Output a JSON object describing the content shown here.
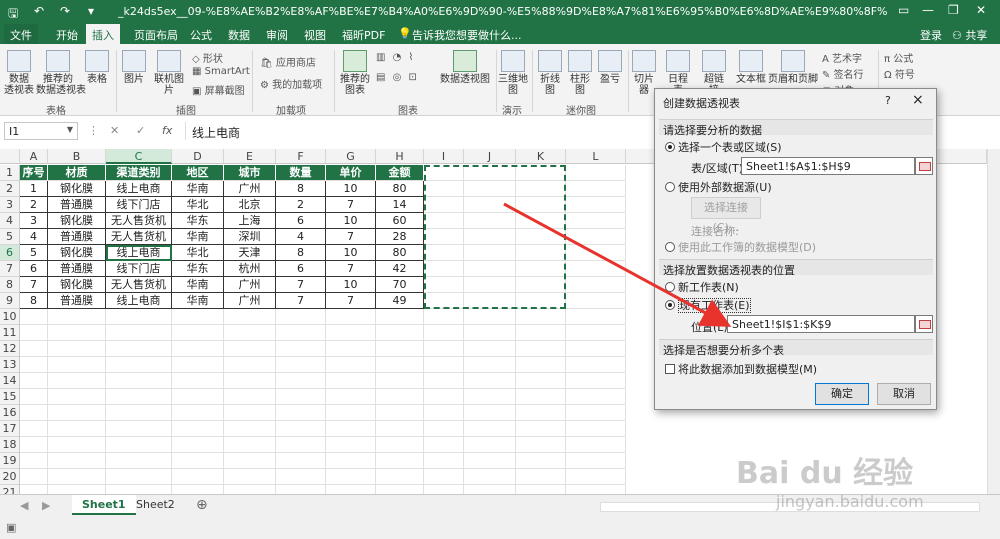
{
  "titlebar": {
    "title": "_k24ds5ex__09-%E8%AE%B2%E8%AF%BE%E7%B4%A0%E6%9D%90-%E5%88%9D%E8%A7%81%E6%95%B0%E6%8D%AE%E9%80%8F%E8%A7%86%E8%A1%A8-%E7%A9%..."
  },
  "tabs": [
    "文件",
    "开始",
    "插入",
    "页面布局",
    "公式",
    "数据",
    "审阅",
    "视图",
    "福昕PDF"
  ],
  "tell_me": "告诉我您想要做什么...",
  "user": {
    "login": "登录",
    "share": "共享"
  },
  "ribbon": {
    "tables": {
      "pivot": "数据\n透视表",
      "recommended": "推荐的\n数据透视表",
      "table": "表格",
      "group": "表格"
    },
    "illustrations": {
      "picture": "图片",
      "online_picture": "联机图片",
      "shapes": "形状",
      "smartart": "SmartArt",
      "screenshot": "屏幕截图",
      "group": "插图"
    },
    "addins": {
      "store": "应用商店",
      "my_addins": "我的加载项",
      "group": "加载项"
    },
    "charts": {
      "recommended": "推荐的\n图表",
      "pivot_chart": "数据透视图",
      "group": "图表"
    },
    "tours": {
      "map3d": "三维地\n图",
      "group": "演示"
    },
    "sparklines": {
      "line": "折线图",
      "column": "柱形图",
      "winloss": "盈亏",
      "group": "迷你图"
    },
    "filters": {
      "slicer": "切片器",
      "timeline": "日程表"
    },
    "links": {
      "hyperlink": "超链接"
    },
    "text": {
      "textbox": "文本框",
      "header_footer": "页眉和页脚",
      "wordart": "艺术字",
      "signature": "签名行",
      "object": "对象"
    },
    "symbols": {
      "equation": "公式",
      "symbol": "符号"
    }
  },
  "formula_bar": {
    "name_box": "I1",
    "content": "线上电商"
  },
  "grid": {
    "columns": [
      "A",
      "B",
      "C",
      "D",
      "E",
      "F",
      "G",
      "H",
      "I",
      "J",
      "K",
      "L"
    ],
    "rows": [
      "1",
      "2",
      "3",
      "4",
      "5",
      "6",
      "7",
      "8",
      "9",
      "10",
      "11",
      "12",
      "13",
      "14",
      "15",
      "16",
      "17",
      "18",
      "19",
      "20",
      "21"
    ],
    "headers": [
      "序号",
      "材质",
      "渠道类别",
      "地区",
      "城市",
      "数量",
      "单价",
      "金额"
    ],
    "data": [
      [
        "1",
        "钢化膜",
        "线上电商",
        "华南",
        "广州",
        "8",
        "10",
        "80"
      ],
      [
        "2",
        "普通膜",
        "线下门店",
        "华北",
        "北京",
        "2",
        "7",
        "14"
      ],
      [
        "3",
        "钢化膜",
        "无人售货机",
        "华东",
        "上海",
        "6",
        "10",
        "60"
      ],
      [
        "4",
        "普通膜",
        "无人售货机",
        "华南",
        "深圳",
        "4",
        "7",
        "28"
      ],
      [
        "5",
        "钢化膜",
        "线上电商",
        "华北",
        "天津",
        "8",
        "10",
        "80"
      ],
      [
        "6",
        "普通膜",
        "线下门店",
        "华东",
        "杭州",
        "6",
        "7",
        "42"
      ],
      [
        "7",
        "钢化膜",
        "无人售货机",
        "华南",
        "广州",
        "7",
        "10",
        "70"
      ],
      [
        "8",
        "普通膜",
        "线上电商",
        "华南",
        "广州",
        "7",
        "7",
        "49"
      ]
    ]
  },
  "sheets": [
    "Sheet1",
    "Sheet2"
  ],
  "dialog": {
    "title": "创建数据透视表",
    "help": "?",
    "close": "×",
    "section1": "请选择要分析的数据",
    "opt_select_range": "选择一个表或区域(S)",
    "table_range_label": "表/区域(T):",
    "table_range_value": "Sheet1!$A$1:$H$9",
    "opt_external": "使用外部数据源(U)",
    "choose_connection": "选择连接(C)...",
    "connection_name": "连接名称:",
    "opt_data_model": "使用此工作簿的数据模型(D)",
    "section2": "选择放置数据透视表的位置",
    "opt_new_sheet": "新工作表(N)",
    "opt_existing_sheet": "现有工作表(E)",
    "location_label": "位置(L):",
    "location_value": "Sheet1!$I$1:$K$9",
    "section3": "选择是否想要分析多个表",
    "add_to_model": "将此数据添加到数据模型(M)",
    "ok": "确定",
    "cancel": "取消"
  },
  "watermark": {
    "brand": "Bai du 经验",
    "url": "jingyan.baidu.com"
  },
  "colors": {
    "excel_green": "#217346",
    "arrow_red": "#e8322c"
  }
}
